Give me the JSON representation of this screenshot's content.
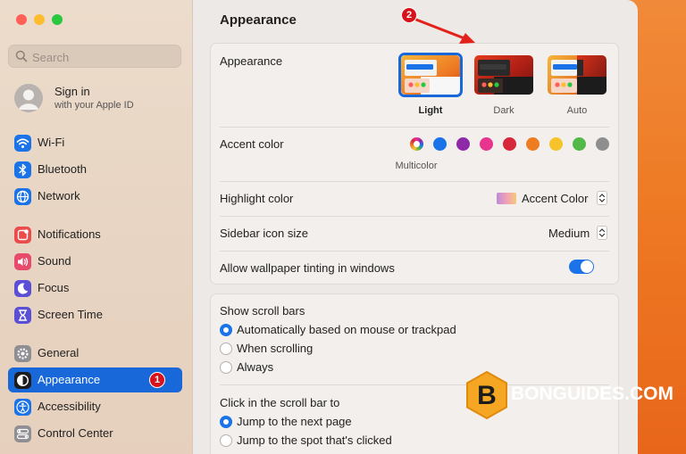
{
  "window": {
    "title": "Appearance"
  },
  "search": {
    "placeholder": "Search"
  },
  "account": {
    "name": "Sign in",
    "subtitle": "with your Apple ID"
  },
  "sidebar": {
    "items": [
      {
        "label": "Wi-Fi",
        "icon": "wifi-icon",
        "color": "#1a73e8"
      },
      {
        "label": "Bluetooth",
        "icon": "bluetooth-icon",
        "color": "#1a73e8"
      },
      {
        "label": "Network",
        "icon": "network-icon",
        "color": "#1a73e8"
      },
      {
        "label": "Notifications",
        "icon": "bell-icon",
        "color": "#ea4b4b"
      },
      {
        "label": "Sound",
        "icon": "speaker-icon",
        "color": "#e84a6b"
      },
      {
        "label": "Focus",
        "icon": "moon-icon",
        "color": "#5b4fd6"
      },
      {
        "label": "Screen Time",
        "icon": "hourglass-icon",
        "color": "#5b4fd6"
      },
      {
        "label": "General",
        "icon": "gear-icon",
        "color": "#8e8e93"
      },
      {
        "label": "Appearance",
        "icon": "appearance-icon",
        "color": "#1c1c1e",
        "selected": true,
        "badge": "1"
      },
      {
        "label": "Accessibility",
        "icon": "accessibility-icon",
        "color": "#1a73e8"
      },
      {
        "label": "Control Center",
        "icon": "control-center-icon",
        "color": "#8e8e93"
      }
    ]
  },
  "appearance_card": {
    "appearance_label": "Appearance",
    "options": [
      {
        "label": "Light",
        "selected": true
      },
      {
        "label": "Dark",
        "selected": false
      },
      {
        "label": "Auto",
        "selected": false
      }
    ],
    "accent_label": "Accent color",
    "accent_colors": [
      "multicolor",
      "#1a73e8",
      "#8e2aa8",
      "#e8338f",
      "#d6283a",
      "#ee7d22",
      "#f7c32b",
      "#52b847",
      "#8e8e8e"
    ],
    "accent_selected_name": "Multicolor",
    "highlight_label": "Highlight color",
    "highlight_value": "Accent Color",
    "sidebar_icon_label": "Sidebar icon size",
    "sidebar_icon_value": "Medium",
    "tinting_label": "Allow wallpaper tinting in windows",
    "tinting_on": true
  },
  "scroll_card": {
    "show_label": "Show scroll bars",
    "show_options": [
      {
        "label": "Automatically based on mouse or trackpad",
        "selected": true
      },
      {
        "label": "When scrolling",
        "selected": false
      },
      {
        "label": "Always",
        "selected": false
      }
    ],
    "click_label": "Click in the scroll bar to",
    "click_options": [
      {
        "label": "Jump to the next page",
        "selected": true
      },
      {
        "label": "Jump to the spot that's clicked",
        "selected": false
      }
    ]
  },
  "callouts": {
    "one": "1",
    "two": "2"
  },
  "watermark": {
    "text": "BONGUIDES.COM",
    "logo_letter": "B"
  },
  "colors": {
    "accent": "#1868d9",
    "callout": "#d6131a",
    "wallpaper": "#ee7a24"
  }
}
